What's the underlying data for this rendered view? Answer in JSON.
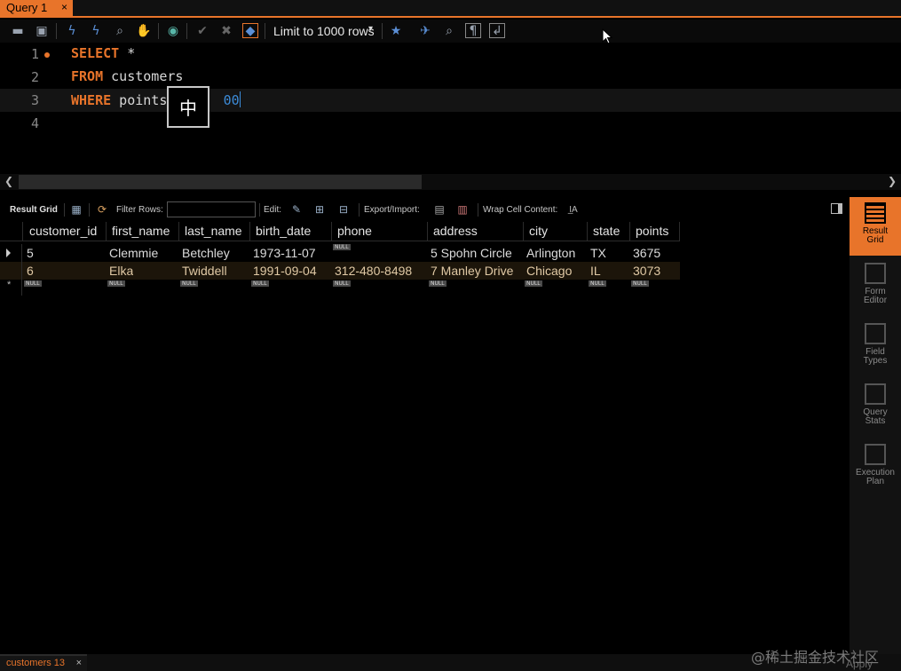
{
  "tabs": {
    "query_tab_label": "Query 1",
    "query_tab_close": "×",
    "bottom_tab_label": "customers 13",
    "bottom_tab_close": "×"
  },
  "toolbar": {
    "icons": [
      "open-folder-icon",
      "save-icon",
      "execute-icon",
      "execute-current-icon",
      "explain-icon",
      "stop-icon",
      "toggle-continue-icon",
      "commit-icon",
      "rollback-icon",
      "autocommit-icon",
      "add-snippet-icon",
      "beautify-icon",
      "find-icon",
      "invisible-chars-icon",
      "wrap-lines-icon"
    ],
    "limit_label": "Limit to 1000 rows",
    "limit_caret": "▾"
  },
  "editor": {
    "line_numbers": [
      "1",
      "2",
      "3",
      "4"
    ],
    "line1_kw": "SELECT",
    "line1_rest": " *",
    "line2_kw": "FROM",
    "line2_rest": " customers",
    "line3_kw": "WHERE",
    "line3_rest": " points ",
    "line3_num": "00",
    "ime_char": "中",
    "active_line": 3,
    "accent": "#e8742a"
  },
  "result_toolbar": {
    "result_grid_label": "Result Grid",
    "filter_rows_label": "Filter Rows:",
    "filter_value": "",
    "edit_label": "Edit:",
    "export_import_label": "Export/Import:",
    "wrap_label": "Wrap Cell Content:",
    "wrap_icon_text": "I̲A"
  },
  "grid": {
    "columns": [
      "customer_id",
      "first_name",
      "last_name",
      "birth_date",
      "phone",
      "address",
      "city",
      "state",
      "points"
    ],
    "rows": [
      [
        "5",
        "Clemmie",
        "Betchley",
        "1973-11-07",
        "",
        "5 Spohn Circle",
        "Arlington",
        "TX",
        "3675"
      ],
      [
        "6",
        "Elka",
        "Twiddell",
        "1991-09-04",
        "312-480-8498",
        "7 Manley Drive",
        "Chicago",
        "IL",
        "3073"
      ]
    ],
    "null_label": "NULL"
  },
  "side_panel": {
    "items": [
      {
        "line1": "Result",
        "line2": "Grid"
      },
      {
        "line1": "Form",
        "line2": "Editor"
      },
      {
        "line1": "Field",
        "line2": "Types"
      },
      {
        "line1": "Query",
        "line2": "Stats"
      },
      {
        "line1": "Execution",
        "line2": "Plan"
      }
    ]
  },
  "footer": {
    "apply_label": "Apply",
    "watermark": "@稀土掘金技术社区"
  }
}
